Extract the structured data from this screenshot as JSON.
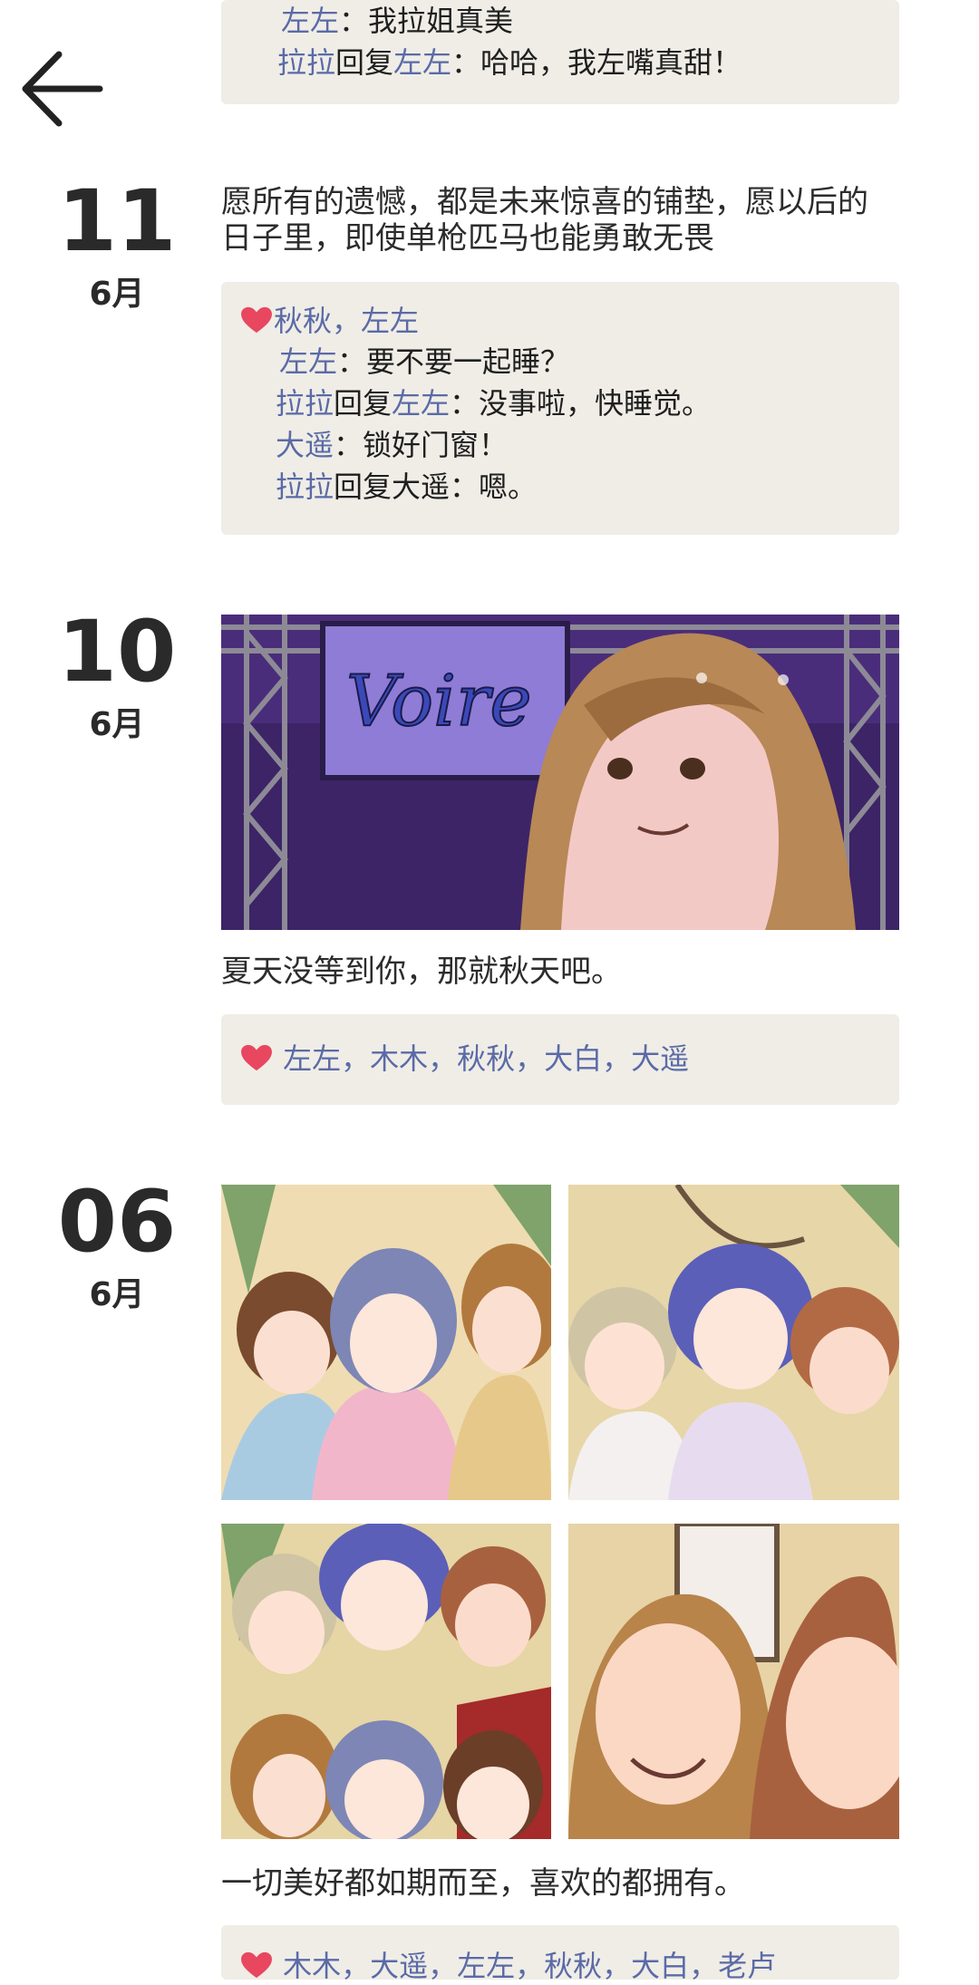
{
  "nav": {
    "back_icon": "arrow-left-icon"
  },
  "colors": {
    "name": "#5b6aa7",
    "heart": "#e8475f",
    "panel": "#efede6"
  },
  "top_block": {
    "c1_name": "左左",
    "c1_text": "：我拉姐真美",
    "c2_name": "拉拉",
    "c2_reply": "回复",
    "c2_target": "左左",
    "c2_text": "：哈哈，我左嘴真甜！"
  },
  "entries": [
    {
      "day": "11",
      "month": "6月",
      "text": "愿所有的遗憾，都是未来惊喜的铺垫，愿以后的日子里，即使单枪匹马也能勇敢无畏",
      "likes": "秋秋，左左",
      "comments": [
        {
          "name": "左左",
          "reply": "",
          "target": "",
          "text": "：要不要一起睡？"
        },
        {
          "name": "拉拉",
          "reply": "回复",
          "target": "左左",
          "text": "：没事啦，快睡觉。"
        },
        {
          "name": "大遥",
          "reply": "",
          "target": "",
          "text": "：锁好门窗！"
        },
        {
          "name": "拉拉",
          "reply": "回复",
          "target": "",
          "text": "大遥：嗯。"
        }
      ]
    },
    {
      "day": "10",
      "month": "6月",
      "image_sign": "Voire",
      "text": "夏天没等到你，那就秋天吧。",
      "likes": "左左，木木，秋秋，大白，大遥"
    },
    {
      "day": "06",
      "month": "6月",
      "text": "一切美好都如期而至，喜欢的都拥有。",
      "likes": "木木，大遥，左左，秋秋，大白，老卢"
    }
  ]
}
